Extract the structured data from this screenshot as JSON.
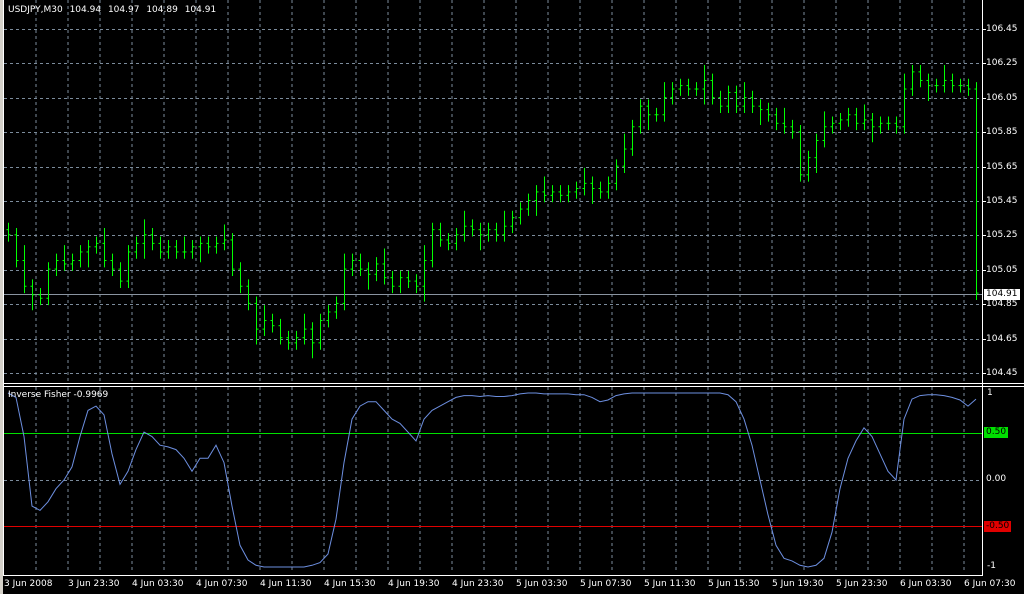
{
  "window": {
    "symbol": "USDJPY,M30",
    "open": "104.94",
    "high": "104.97",
    "low": "104.89",
    "close": "104.91"
  },
  "indicator": {
    "label": "Inverse Fisher -0.9969"
  },
  "price_axis": [
    "106.45",
    "106.25",
    "106.05",
    "105.85",
    "105.65",
    "105.45",
    "105.25",
    "105.05",
    "104.85",
    "104.65",
    "104.45"
  ],
  "current_price": "104.91",
  "indicator_axis": {
    "top": "1",
    "upper": "0.50",
    "zero": "0.00",
    "lower": "-0.50",
    "bottom": "-1"
  },
  "colors": {
    "bars": "#00ff00",
    "fisher": "#6d8fe0",
    "upper_level": "#00e000",
    "lower_level": "#e00000",
    "grid": "#7c8c9c"
  },
  "time_axis": [
    "3 Jun 2008",
    "3 Jun 23:30",
    "4 Jun 03:30",
    "4 Jun 07:30",
    "4 Jun 11:30",
    "4 Jun 15:30",
    "4 Jun 19:30",
    "4 Jun 23:30",
    "5 Jun 03:30",
    "5 Jun 07:30",
    "5 Jun 11:30",
    "5 Jun 15:30",
    "5 Jun 19:30",
    "5 Jun 23:30",
    "6 Jun 03:30",
    "6 Jun 07:30"
  ],
  "chart_data": {
    "type": "ohlc",
    "title": "USDJPY,M30",
    "ylim": [
      104.4,
      106.5
    ],
    "first_open": 105.28,
    "closes": [
      105.25,
      105.1,
      104.95,
      104.9,
      104.88,
      105.05,
      105.1,
      105.08,
      105.1,
      105.15,
      105.18,
      105.2,
      105.1,
      105.05,
      104.98,
      105.15,
      105.2,
      105.25,
      105.2,
      105.15,
      105.18,
      105.15,
      105.15,
      105.18,
      105.2,
      105.18,
      105.2,
      105.22,
      105.05,
      104.95,
      104.85,
      104.7,
      104.75,
      104.72,
      104.65,
      104.62,
      104.65,
      104.7,
      104.62,
      104.75,
      104.8,
      104.85,
      105.05,
      105.1,
      105.05,
      105.02,
      105.08,
      105.0,
      104.95,
      105.0,
      104.98,
      104.95,
      105.1,
      105.28,
      105.22,
      105.2,
      105.25,
      105.3,
      105.28,
      105.25,
      105.28,
      105.25,
      105.3,
      105.35,
      105.4,
      105.45,
      105.5,
      105.48,
      105.5,
      105.48,
      105.5,
      105.52,
      105.55,
      105.52,
      105.5,
      105.55,
      105.65,
      105.75,
      105.88,
      106.0,
      105.95,
      105.95,
      106.05,
      106.1,
      106.12,
      106.1,
      106.1,
      106.15,
      106.05,
      106.0,
      106.08,
      106.0,
      106.05,
      106.0,
      105.98,
      105.95,
      105.9,
      105.88,
      105.85,
      105.6,
      105.7,
      105.8,
      105.88,
      105.9,
      105.92,
      105.95,
      105.9,
      105.92,
      105.88,
      105.9,
      105.9,
      105.88,
      106.1,
      106.2,
      106.15,
      106.12,
      106.12,
      106.15,
      106.12,
      106.12,
      106.1,
      104.91
    ],
    "indicator": {
      "name": "Inverse Fisher",
      "ylim": [
        -1,
        1
      ],
      "levels": [
        0.5,
        0,
        -0.5
      ],
      "values": [
        1,
        0.95,
        0.5,
        -0.3,
        -0.35,
        -0.25,
        -0.1,
        0,
        0.15,
        0.5,
        0.8,
        0.85,
        0.75,
        0.3,
        -0.05,
        0.1,
        0.35,
        0.55,
        0.5,
        0.4,
        0.38,
        0.35,
        0.25,
        0.1,
        0.25,
        0.25,
        0.4,
        0.2,
        -0.3,
        -0.75,
        -0.92,
        -0.98,
        -1,
        -1,
        -1,
        -1,
        -1,
        -1,
        -0.98,
        -0.95,
        -0.85,
        -0.45,
        0.2,
        0.7,
        0.85,
        0.9,
        0.9,
        0.8,
        0.7,
        0.65,
        0.55,
        0.45,
        0.7,
        0.8,
        0.85,
        0.9,
        0.95,
        0.97,
        0.97,
        0.96,
        0.97,
        0.96,
        0.96,
        0.97,
        0.99,
        1,
        1,
        0.99,
        0.99,
        0.99,
        0.99,
        0.98,
        0.98,
        0.95,
        0.9,
        0.92,
        0.97,
        0.99,
        1,
        1,
        1,
        1,
        1,
        1,
        1,
        1,
        1,
        1,
        1,
        1,
        0.98,
        0.9,
        0.7,
        0.4,
        0,
        -0.4,
        -0.75,
        -0.9,
        -0.93,
        -0.98,
        -1,
        -0.98,
        -0.9,
        -0.6,
        -0.1,
        0.25,
        0.45,
        0.6,
        0.5,
        0.3,
        0.1,
        0,
        0.7,
        0.93,
        0.97,
        0.98,
        0.98,
        0.97,
        0.95,
        0.92,
        0.85,
        0.93
      ]
    }
  }
}
